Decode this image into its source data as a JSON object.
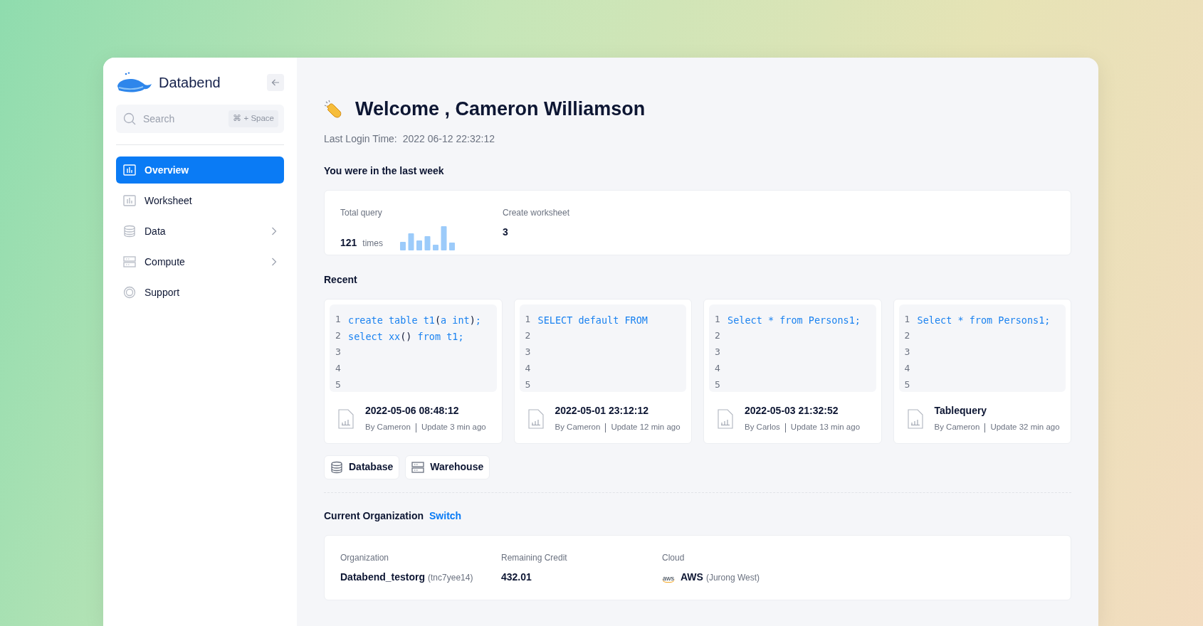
{
  "sidebar": {
    "brand": "Databend",
    "search": {
      "placeholder": "Search",
      "shortcut": "⌘ + Space"
    },
    "items": [
      {
        "label": "Overview",
        "kind": "chart",
        "selected": true,
        "has_submenu": false
      },
      {
        "label": "Worksheet",
        "kind": "chart",
        "selected": false,
        "has_submenu": false
      },
      {
        "label": "Data",
        "kind": "database",
        "selected": false,
        "has_submenu": true
      },
      {
        "label": "Compute",
        "kind": "server",
        "selected": false,
        "has_submenu": true
      },
      {
        "label": "Support",
        "kind": "lifebuoy",
        "selected": false,
        "has_submenu": false
      }
    ]
  },
  "welcome": {
    "title": "Welcome , Cameron Williamson",
    "last_login_label": "Last Login Time:",
    "last_login_value": "2022 06-12 22:32:12"
  },
  "last_week": {
    "title": "You were in the last week",
    "stats": [
      {
        "label": "Total query",
        "value": "121",
        "unit": "times",
        "kind": "sparkline"
      },
      {
        "label": "Create worksheet",
        "value": "3",
        "kind": "plain"
      }
    ]
  },
  "recent": {
    "title": "Recent",
    "items": [
      {
        "lines": [
          {
            "number": "1",
            "code": "create table t1(a int);"
          },
          {
            "number": "2",
            "code": "select xx() from t1;"
          },
          {
            "number": "3"
          },
          {
            "number": "4"
          },
          {
            "number": "5"
          }
        ],
        "title": "2022-05-06 08:48:12",
        "author": "By Cameron",
        "updated": "Update 3 min ago"
      },
      {
        "lines": [
          {
            "number": "1",
            "code": "SELECT default FROM"
          },
          {
            "number": "2"
          },
          {
            "number": "3"
          },
          {
            "number": "4"
          },
          {
            "number": "5"
          }
        ],
        "title": "2022-05-01 23:12:12",
        "author": "By Cameron",
        "updated": "Update 12 min ago"
      },
      {
        "lines": [
          {
            "number": "1",
            "code": "Select * from Persons1;"
          },
          {
            "number": "2"
          },
          {
            "number": "3"
          },
          {
            "number": "4"
          },
          {
            "number": "5"
          }
        ],
        "title": "2022-05-03 21:32:52",
        "author": "By Carlos",
        "updated": "Update 13 min ago"
      },
      {
        "lines": [
          {
            "number": "1",
            "code": "Select * from Persons1;"
          },
          {
            "number": "2"
          },
          {
            "number": "3"
          },
          {
            "number": "4"
          },
          {
            "number": "5"
          }
        ],
        "title": "Tablequery",
        "author": "By Cameron",
        "updated": "Update 32 min ago"
      }
    ]
  },
  "shortcuts": [
    {
      "label": "Database",
      "kind": "database"
    },
    {
      "label": "Warehouse",
      "kind": "server"
    }
  ],
  "organization": {
    "title": "Current Organization",
    "switch": "Switch",
    "fields": [
      {
        "label": "Organization",
        "value": "Databend_testorg",
        "note": "(tnc7yee14)",
        "kind": "plain"
      },
      {
        "label": "Remaining Credit",
        "value": "432.01",
        "kind": "plain"
      },
      {
        "label": "Cloud",
        "value": "AWS",
        "note": "(Jurong West)",
        "logo_text": "aws",
        "kind": "cloud"
      }
    ]
  }
}
